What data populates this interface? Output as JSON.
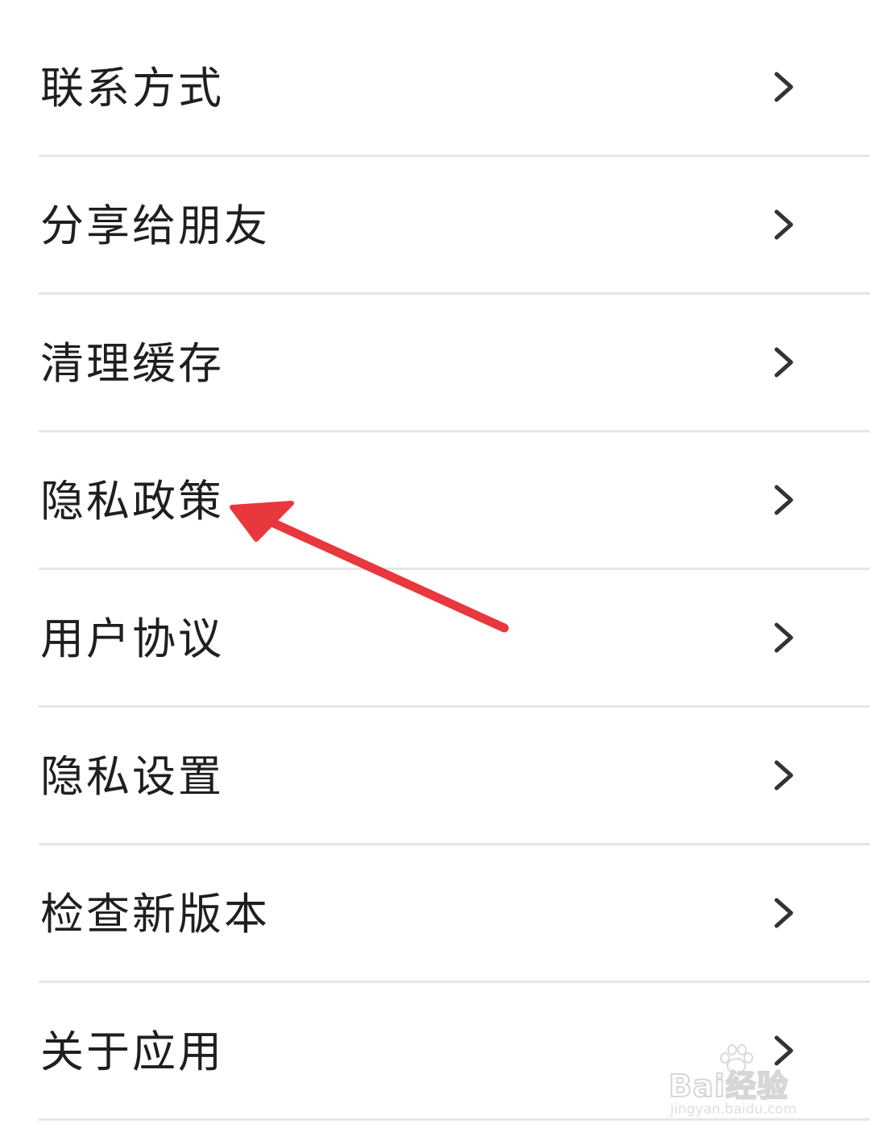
{
  "menu": {
    "items": [
      {
        "label": "联系方式",
        "icon": "chevron-right-icon"
      },
      {
        "label": "分享给朋友",
        "icon": "chevron-right-icon"
      },
      {
        "label": "清理缓存",
        "icon": "chevron-right-icon"
      },
      {
        "label": "隐私政策",
        "icon": "chevron-right-icon"
      },
      {
        "label": "用户协议",
        "icon": "chevron-right-icon"
      },
      {
        "label": "隐私设置",
        "icon": "chevron-right-icon"
      },
      {
        "label": "检查新版本",
        "icon": "chevron-right-icon"
      },
      {
        "label": "关于应用",
        "icon": "chevron-right-icon"
      }
    ]
  },
  "annotation": {
    "type": "red-arrow",
    "points_to": "隐私政策",
    "color": "#e8373d"
  },
  "watermark": {
    "brand": "Bai经验",
    "url": "jingyan.baidu.com"
  },
  "colors": {
    "text": "#1f1f1f",
    "chevron": "#333333",
    "divider": "#e6e6e6",
    "background": "#ffffff"
  }
}
